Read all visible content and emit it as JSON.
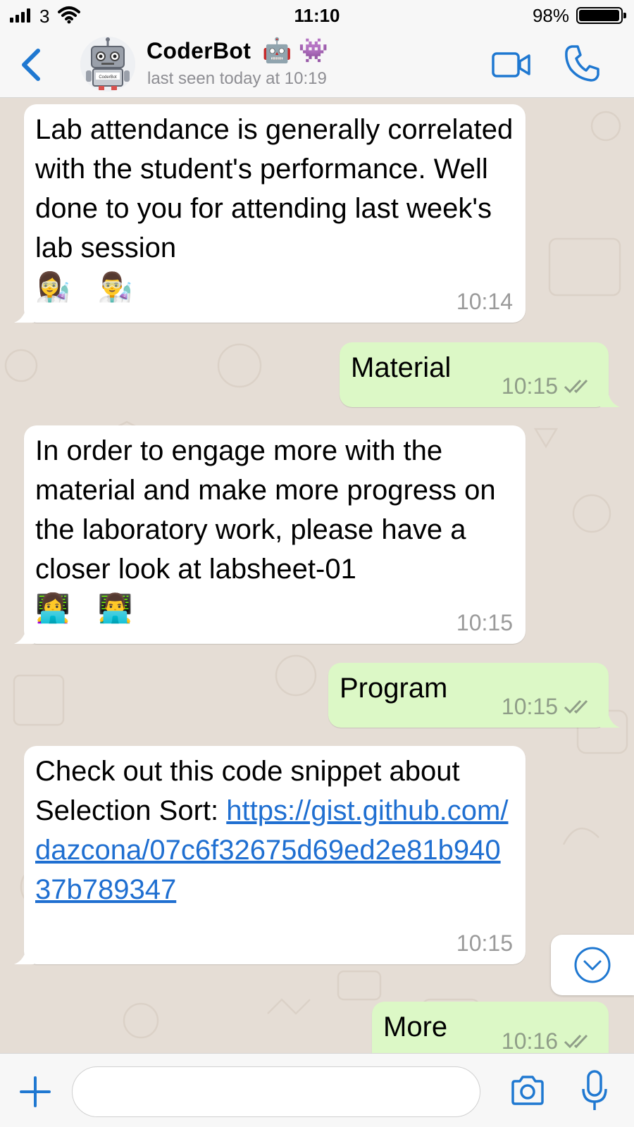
{
  "status_bar": {
    "carrier": "3",
    "time": "11:10",
    "battery_percent": "98%",
    "battery_level": 0.98
  },
  "header": {
    "contact_name": "CoderBot",
    "contact_emoji": "🤖 👾",
    "last_seen": "last seen today at 10:19",
    "avatar_label": "CoderBot",
    "icons": [
      "chevron-left-icon",
      "video-camera-icon",
      "phone-icon"
    ]
  },
  "messages": [
    {
      "direction": "in",
      "text": "Lab attendance is generally correlated with the student's performance. Well done to you for attending last week's lab session",
      "emojis": "👩‍🔬 👨‍🔬",
      "time": "10:14"
    },
    {
      "direction": "out",
      "text": "Material",
      "time": "10:15",
      "status": "read"
    },
    {
      "direction": "in",
      "text": "In order to engage more with the material and make more progress on the laboratory work, please have a closer look at labsheet-01",
      "emojis": "👩‍💻 👨‍💻",
      "time": "10:15"
    },
    {
      "direction": "out",
      "text": "Program",
      "time": "10:15",
      "status": "read"
    },
    {
      "direction": "in",
      "text": "Check out this code snippet about Selection Sort:",
      "link": "https://gist.github.com/dazcona/07c6f32675d69ed2e81b94037b789347",
      "time": "10:15"
    },
    {
      "direction": "out",
      "text": "More",
      "time": "10:16",
      "status": "read"
    }
  ],
  "input_bar": {
    "placeholder": "",
    "value": "",
    "icons": [
      "plus-icon",
      "camera-icon",
      "microphone-icon"
    ]
  },
  "colors": {
    "accent": "#1f78d1",
    "incoming_bubble": "#ffffff",
    "outgoing_bubble": "#dcf8c6",
    "chat_background": "#e5ddd5"
  }
}
